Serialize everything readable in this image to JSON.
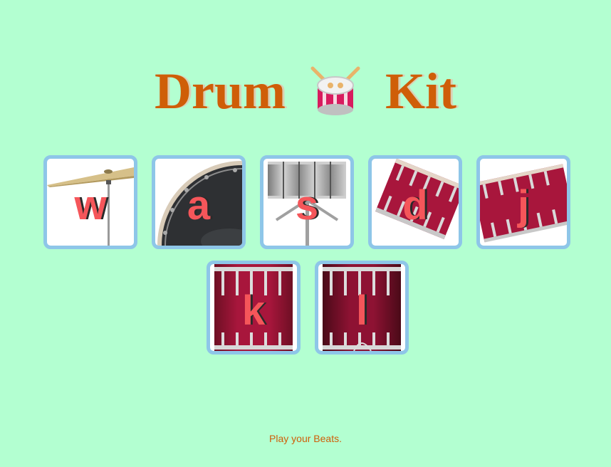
{
  "header": {
    "title_left": "Drum",
    "title_right": "Kit",
    "logo_icon": "drum-with-sticks-icon"
  },
  "drums": [
    {
      "key": "w",
      "image": "crash-cymbal"
    },
    {
      "key": "a",
      "image": "kick-drum"
    },
    {
      "key": "s",
      "image": "snare-drum"
    },
    {
      "key": "d",
      "image": "tom-1"
    },
    {
      "key": "j",
      "image": "tom-2"
    },
    {
      "key": "k",
      "image": "tom-3"
    },
    {
      "key": "l",
      "image": "tom-4"
    }
  ],
  "footer": {
    "text": "Play your Beats."
  },
  "colors": {
    "background": "#b3ffd1",
    "title": "#cf5e08",
    "key_letter": "#f5565a",
    "tile_border": "#8ec6e8",
    "drum_red": "#a8163c"
  }
}
